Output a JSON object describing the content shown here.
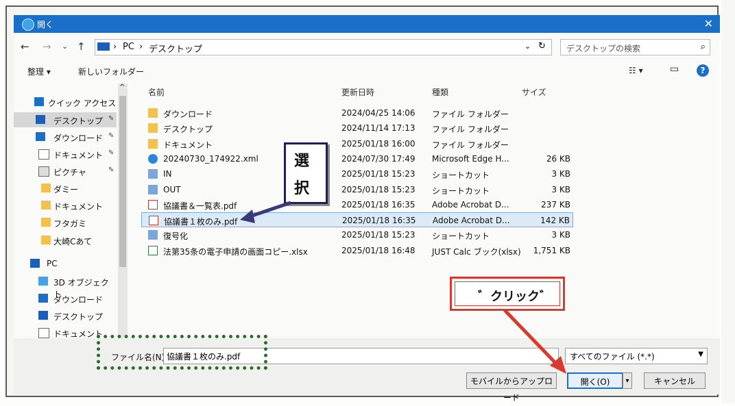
{
  "window": {
    "title": "開く",
    "close": "✕"
  },
  "nav": {
    "back": "←",
    "forward": "→",
    "down": "⌄",
    "up": "↑"
  },
  "address": {
    "parts": [
      "PC",
      "デスクトップ"
    ],
    "sep": "›",
    "dropdown": "⌄",
    "refresh": "↻"
  },
  "search": {
    "placeholder": "デスクトップの検索",
    "icon": "⌕"
  },
  "toolbar": {
    "organize": "整理 ▾",
    "new_folder": "新しいフォルダー",
    "view": "☷ ▾",
    "pane": "▭",
    "help": "?"
  },
  "sidebar": {
    "items": [
      {
        "label": "クイック アクセス",
        "icon": "star-icon"
      },
      {
        "label": "デスクトップ",
        "icon": "desktop-icon",
        "pin": "✎"
      },
      {
        "label": "ダウンロード",
        "icon": "download-icon",
        "pin": "✎"
      },
      {
        "label": "ドキュメント",
        "icon": "document-icon",
        "pin": "✎"
      },
      {
        "label": "ピクチャ",
        "icon": "picture-icon",
        "pin": "✎"
      },
      {
        "label": "ダミー",
        "icon": "folder-icon"
      },
      {
        "label": "ドキュメント",
        "icon": "folder-icon"
      },
      {
        "label": "フタガミ",
        "icon": "folder-icon"
      },
      {
        "label": "大崎Cあて",
        "icon": "folder-icon"
      },
      {
        "label": "PC",
        "icon": "pc-icon"
      },
      {
        "label": "3D オブジェクト",
        "icon": "cube-icon"
      },
      {
        "label": "ダウンロード",
        "icon": "download-icon"
      },
      {
        "label": "デスクトップ",
        "icon": "desktop-icon"
      },
      {
        "label": "ドキュメント",
        "icon": "document-icon"
      }
    ]
  },
  "columns": {
    "name": "名前",
    "date": "更新日時",
    "type": "種類",
    "size": "サイズ"
  },
  "files": [
    {
      "name": "ダウンロード",
      "date": "2024/04/25 14:06",
      "type": "ファイル フォルダー",
      "size": "",
      "icon": "folder"
    },
    {
      "name": "デスクトップ",
      "date": "2024/11/14 17:13",
      "type": "ファイル フォルダー",
      "size": "",
      "icon": "folder"
    },
    {
      "name": "ドキュメント",
      "date": "2025/01/18 16:00",
      "type": "ファイル フォルダー",
      "size": "",
      "icon": "folder"
    },
    {
      "name": "20240730_174922.xml",
      "date": "2024/07/30 17:49",
      "type": "Microsoft Edge H...",
      "size": "26 KB",
      "icon": "edge"
    },
    {
      "name": "IN",
      "date": "2025/01/18 15:23",
      "type": "ショートカット",
      "size": "3 KB",
      "icon": "shortcut"
    },
    {
      "name": "OUT",
      "date": "2025/01/18 15:23",
      "type": "ショートカット",
      "size": "3 KB",
      "icon": "shortcut"
    },
    {
      "name": "協議書＆一覧表.pdf",
      "date": "2025/01/18 16:35",
      "type": "Adobe Acrobat D...",
      "size": "237 KB",
      "icon": "pdf"
    },
    {
      "name": "協議書１枚のみ.pdf",
      "date": "2025/01/18 16:35",
      "type": "Adobe Acrobat D...",
      "size": "142 KB",
      "icon": "pdf",
      "selected": true
    },
    {
      "name": "復号化",
      "date": "2025/01/18 15:23",
      "type": "ショートカット",
      "size": "3 KB",
      "icon": "shortcut"
    },
    {
      "name": "法第35条の電子申請の画面コピー.xlsx",
      "date": "2025/01/18 16:48",
      "type": "JUST Calc ブック(xlsx)",
      "size": "1,751 KB",
      "icon": "xlsx"
    }
  ],
  "bottom": {
    "filename_label": "ファイル名(N):",
    "filename_value": "協議書１枚のみ.pdf",
    "filetype": "すべてのファイル (*.*)",
    "upload_button": "モバイルからアップロード",
    "open_button": "開く(O)",
    "open_dropdown": "▾",
    "cancel_button": "キャンセル"
  },
  "annotations": {
    "select_chars": [
      "選",
      "択"
    ],
    "click_label": "゛クリック゛"
  },
  "colors": {
    "accent": "#1a6fc9",
    "annotation_red": "#d83a2f",
    "annotation_green": "#2b6e2b",
    "annotation_navy": "#1e1e5a"
  }
}
